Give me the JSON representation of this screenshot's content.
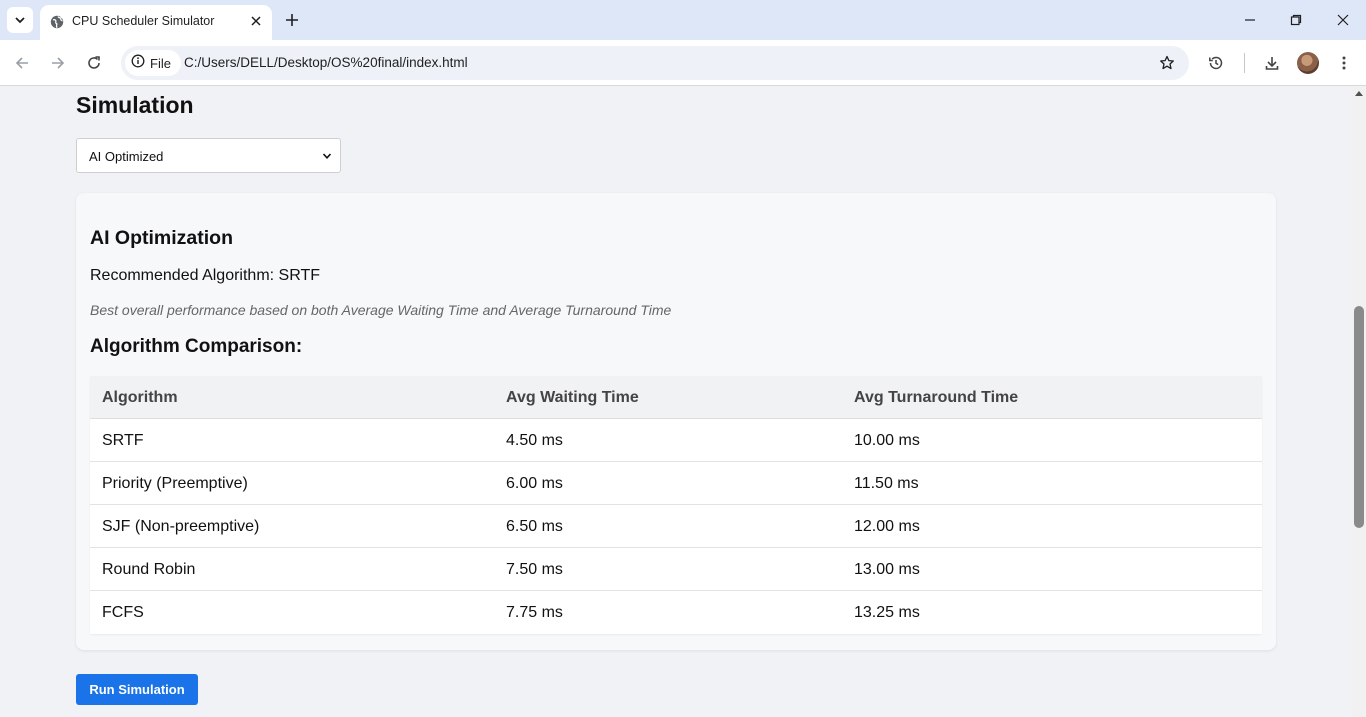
{
  "browser": {
    "tab_title": "CPU Scheduler Simulator",
    "chip_label": "File",
    "url": "C:/Users/DELL/Desktop/OS%20final/index.html"
  },
  "page": {
    "section_title": "Simulation",
    "algorithm_select": {
      "selected": "AI Optimized"
    },
    "ai_card": {
      "heading": "AI Optimization",
      "recommended": "Recommended Algorithm: SRTF",
      "reason": "Best overall performance based on both Average Waiting Time and Average Turnaround Time",
      "comparison_heading": "Algorithm Comparison:",
      "table": {
        "headers": [
          "Algorithm",
          "Avg Waiting Time",
          "Avg Turnaround Time"
        ],
        "rows": [
          [
            "SRTF",
            "4.50 ms",
            "10.00 ms"
          ],
          [
            "Priority (Preemptive)",
            "6.00 ms",
            "11.50 ms"
          ],
          [
            "SJF (Non-preemptive)",
            "6.50 ms",
            "12.00 ms"
          ],
          [
            "Round Robin",
            "7.50 ms",
            "13.00 ms"
          ],
          [
            "FCFS",
            "7.75 ms",
            "13.25 ms"
          ]
        ]
      }
    },
    "run_button": "Run Simulation"
  },
  "colors": {
    "accent": "#1a73e8",
    "page_bg": "#f0f2f5",
    "chrome_bg": "#dee7f8"
  },
  "icons": [
    "tab-search-icon",
    "globe-icon",
    "close-icon",
    "plus-icon",
    "minimize-icon",
    "restore-icon",
    "back-arrow-icon",
    "forward-arrow-icon",
    "reload-icon",
    "info-icon",
    "star-icon",
    "history-icon",
    "download-icon",
    "menu-dots-icon",
    "chevron-down-icon"
  ]
}
